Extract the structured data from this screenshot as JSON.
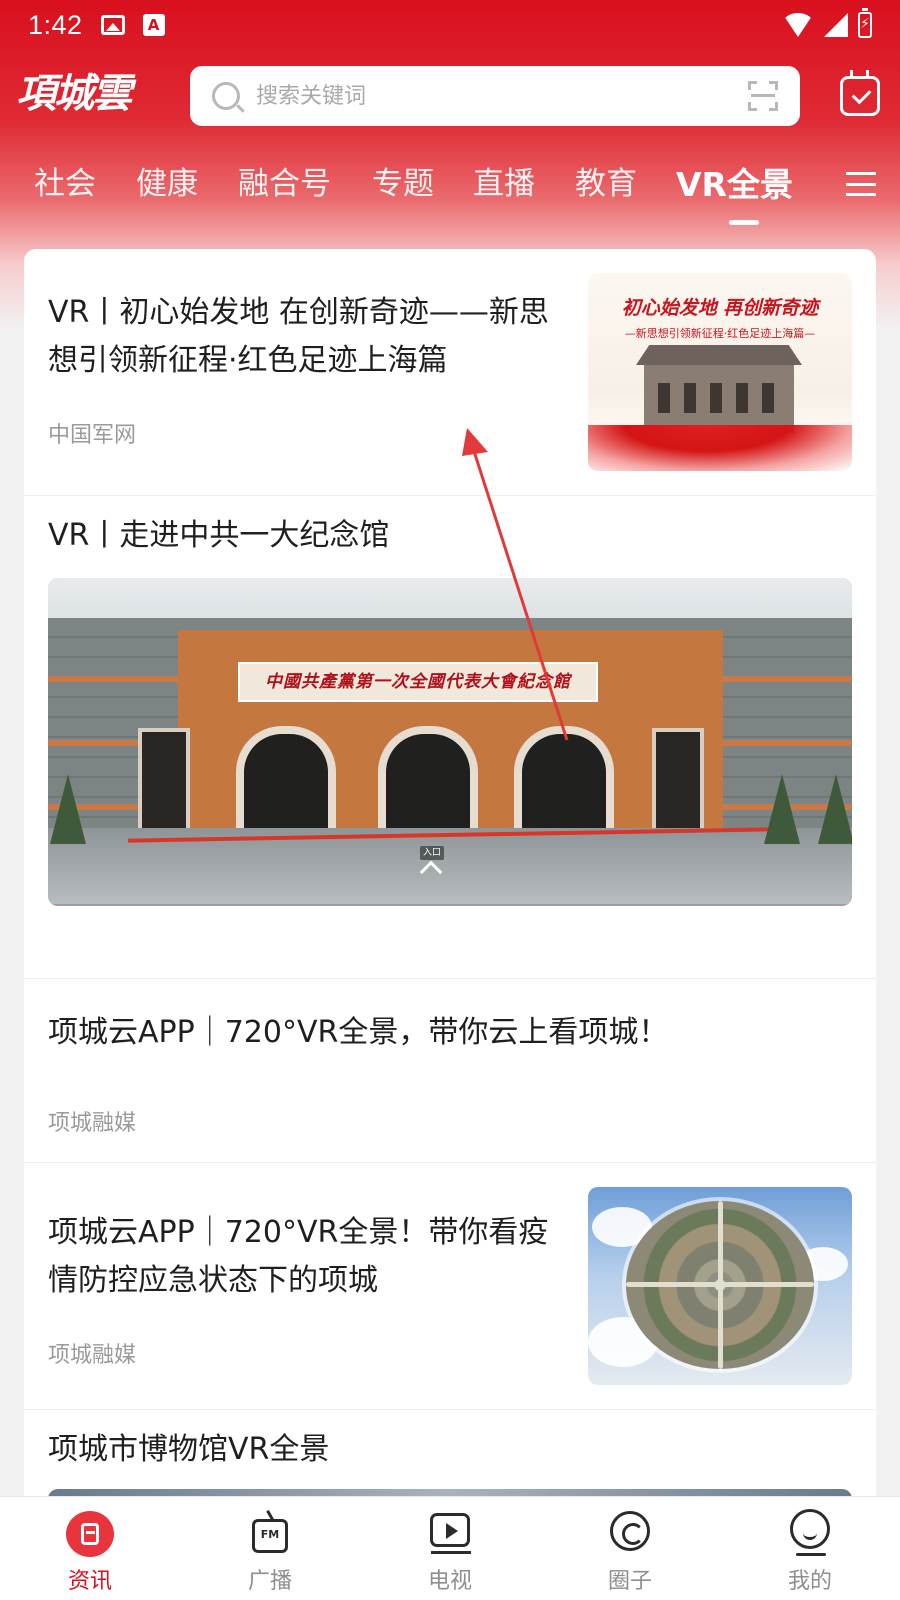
{
  "status_bar": {
    "time": "1:42",
    "icons": [
      "image-icon",
      "a-icon",
      "wifi-icon",
      "signal-icon",
      "battery-icon"
    ]
  },
  "header": {
    "logo_text": "項城雲",
    "search_placeholder": "搜索关键词",
    "search_value": ""
  },
  "tabs": [
    {
      "label": "社会",
      "active": false
    },
    {
      "label": "健康",
      "active": false
    },
    {
      "label": "融合号",
      "active": false
    },
    {
      "label": "专题",
      "active": false
    },
    {
      "label": "直播",
      "active": false
    },
    {
      "label": "教育",
      "active": false
    },
    {
      "label": "VR全景",
      "active": true
    }
  ],
  "feed": [
    {
      "title_line1": "VR丨初心始发地 在创新奇迹——新思",
      "title_line2": "想引领新征程·红色足迹上海篇",
      "source": "中国军网",
      "thumb_title": "初心始发地 再创新奇迹",
      "thumb_subtitle": "—新思想引领新征程·红色足迹上海篇—"
    },
    {
      "title": "VR丨走进中共一大纪念馆",
      "image_sign": "中國共產黨第一次全國代表大會紀念館",
      "image_overlay_label": "入口"
    },
    {
      "title": "项城云APP｜720°VR全景，带你云上看项城！",
      "source": "项城融媒"
    },
    {
      "title_line1": "项城云APP｜720°VR全景！带你看疫",
      "title_line2": "情防控应急状态下的项城",
      "source": "项城融媒"
    },
    {
      "title": "项城市博物馆VR全景"
    }
  ],
  "bottom_nav": [
    {
      "label": "资讯",
      "icon": "news-icon",
      "active": true
    },
    {
      "label": "广播",
      "icon": "radio-fm-icon",
      "active": false
    },
    {
      "label": "电视",
      "icon": "tv-play-icon",
      "active": false
    },
    {
      "label": "圈子",
      "icon": "circle-icon",
      "active": false
    },
    {
      "label": "我的",
      "icon": "profile-icon",
      "active": false
    }
  ],
  "colors": {
    "brand_red": "#d9101e",
    "annotation_arrow": "#e03a3a"
  }
}
